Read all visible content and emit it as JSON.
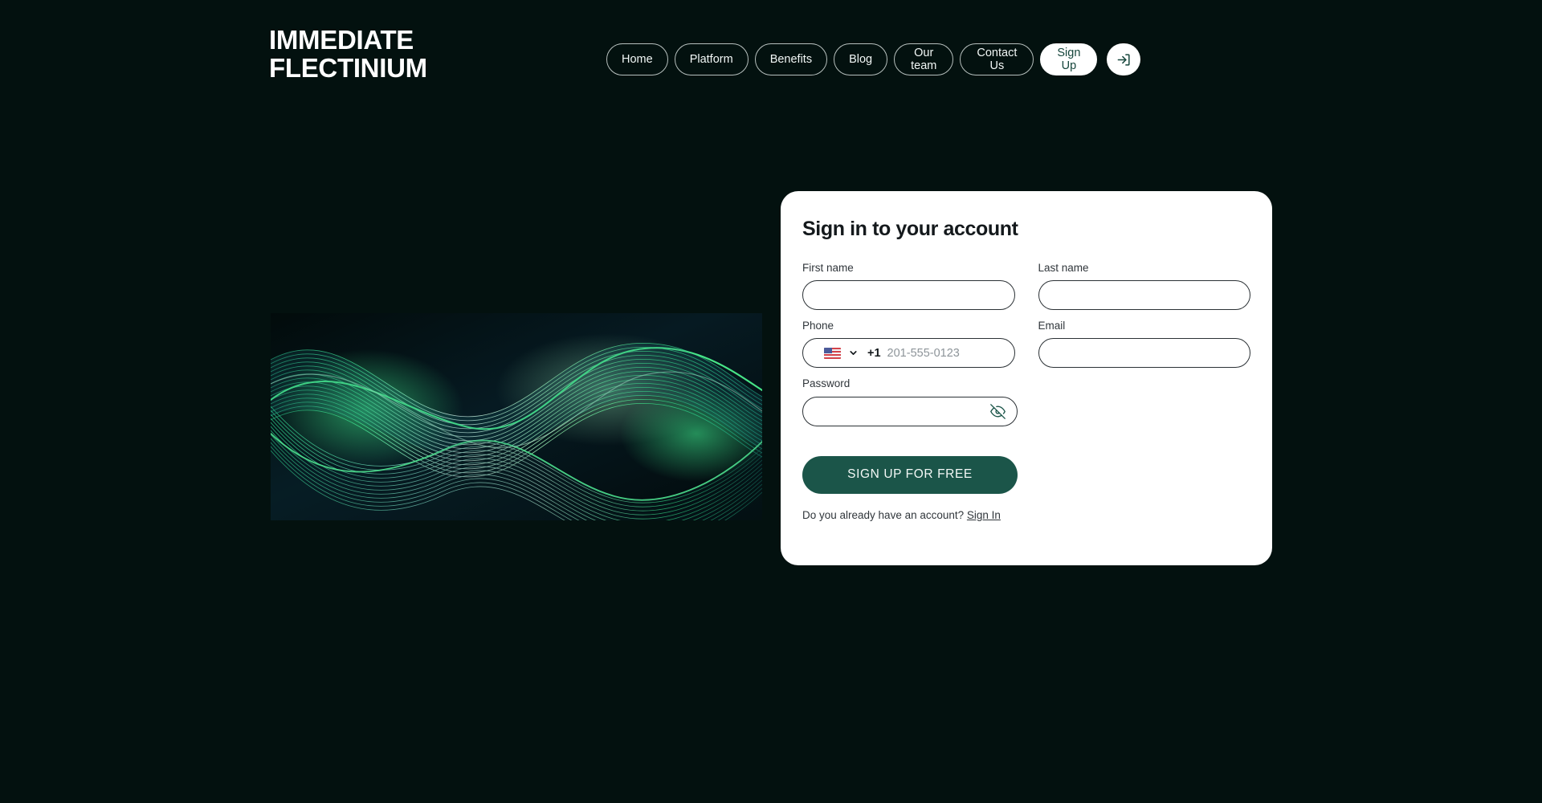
{
  "brand": {
    "logo_line1": "IMMEDIATE",
    "logo_line2": "FLECTINIUM",
    "logo_text": "IMMEDIATE\nFLECTINIUM"
  },
  "colors": {
    "page_background": "#03110f",
    "card_background": "#ffffff",
    "accent_green": "#1b5549",
    "nav_text": "#f2f7f6",
    "label_text": "#30363b",
    "placeholder_text": "#8d9499"
  },
  "nav": {
    "items": [
      {
        "label": "Home",
        "style": "outline",
        "icon": ""
      },
      {
        "label": "Platform",
        "style": "outline",
        "icon": ""
      },
      {
        "label": "Benefits",
        "style": "outline",
        "icon": ""
      },
      {
        "label": "Blog",
        "style": "outline",
        "icon": ""
      },
      {
        "label": "Our\nteam",
        "style": "outline",
        "icon": ""
      },
      {
        "label": "Contact\nUs",
        "style": "outline",
        "icon": ""
      },
      {
        "label": "Sign\nUp",
        "style": "primary",
        "icon": ""
      }
    ],
    "login_icon": "login-arrow-icon"
  },
  "hero": {
    "artwork_name": "abstract-green-wave-artwork"
  },
  "form": {
    "title": "Sign in to your account",
    "fields": {
      "first_name": {
        "label": "First name",
        "value": "",
        "placeholder": ""
      },
      "last_name": {
        "label": "Last name",
        "value": "",
        "placeholder": ""
      },
      "phone": {
        "label": "Phone",
        "value": "",
        "placeholder": "201-555-0123",
        "country_flag": "us-flag-icon",
        "dial_code": "+1",
        "chevron": "chevron-down-icon"
      },
      "email": {
        "label": "Email",
        "value": "",
        "placeholder": ""
      },
      "password": {
        "label": "Password",
        "value": "",
        "placeholder": "",
        "visibility_icon": "eye-off-icon"
      }
    },
    "submit_label": "SIGN UP FOR FREE",
    "footer_text": "Do you already have an account?",
    "footer_link": "Sign In"
  }
}
